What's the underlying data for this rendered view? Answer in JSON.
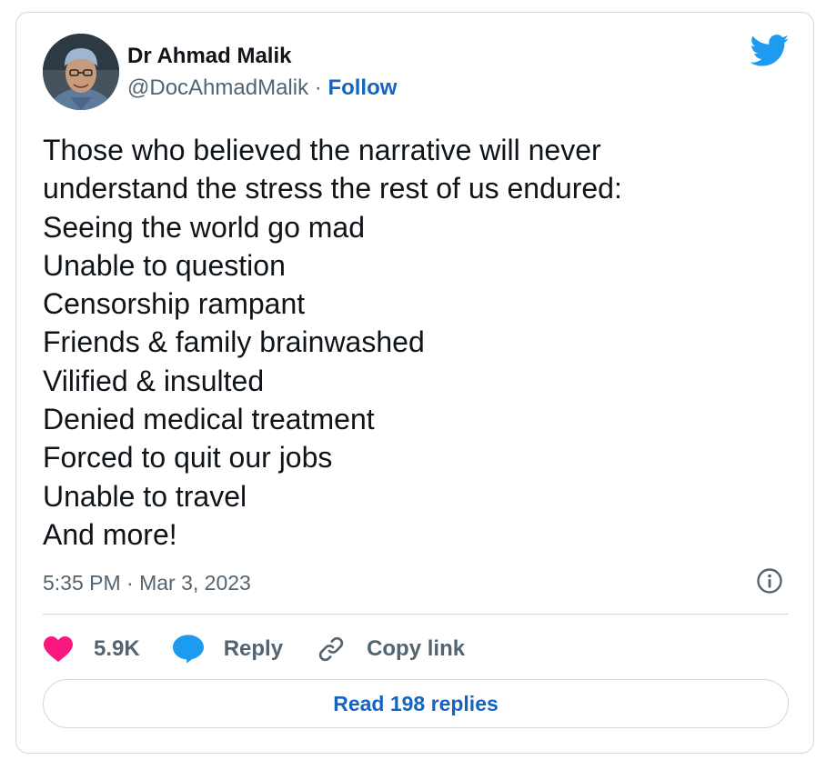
{
  "author": {
    "name": "Dr Ahmad Malik",
    "handle": "@DocAhmadMalik",
    "separator": "·",
    "follow_label": "Follow",
    "avatar_icon": "avatar-photo"
  },
  "platform_icon": "twitter-bird-icon",
  "tweet": {
    "lines": [
      "Those who believed the narrative will never",
      "understand the stress the rest of us endured:",
      "Seeing the world go mad",
      "Unable to question",
      "Censorship rampant",
      "Friends & family brainwashed",
      "Vilified & insulted",
      "Denied medical treatment",
      "Forced to quit our jobs",
      "Unable to travel",
      "And more!"
    ],
    "timestamp": "5:35 PM · Mar 3, 2023"
  },
  "actions": {
    "likes": "5.9K",
    "reply_label": "Reply",
    "copy_link_label": "Copy link"
  },
  "read_replies_label": "Read 198 replies",
  "colors": {
    "link_blue": "#1565c0",
    "twitter_blue": "#1d9bf0",
    "heart_pink": "#f91880",
    "text_primary": "#0f1419",
    "text_secondary": "#536471",
    "border": "#cfd9de"
  }
}
